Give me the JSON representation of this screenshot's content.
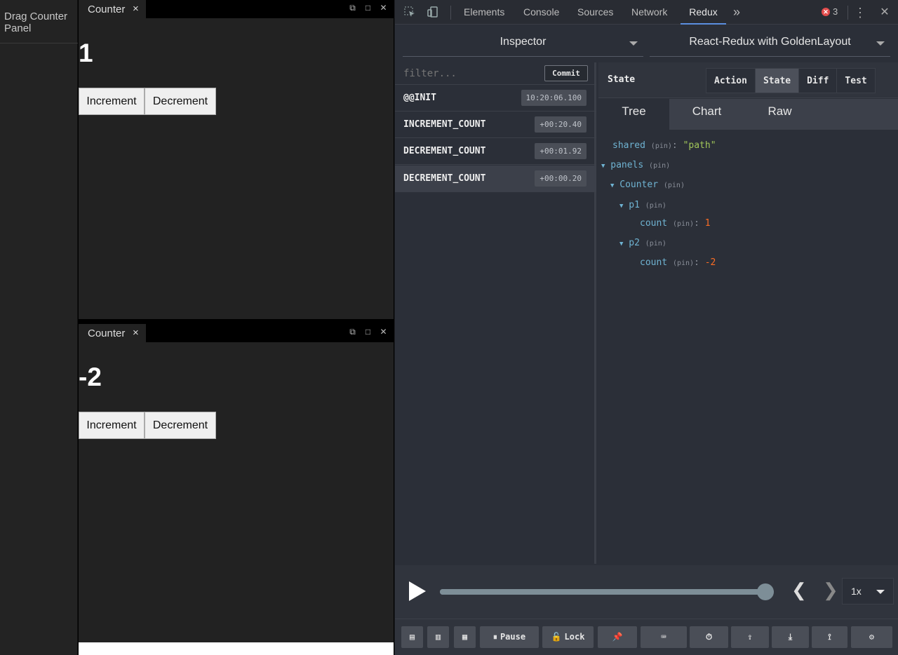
{
  "app": {
    "sidebar_item": "Drag Counter Panel",
    "panels": [
      {
        "tab": "Counter",
        "close": "×",
        "count": "1",
        "increment": "Increment",
        "decrement": "Decrement"
      },
      {
        "tab": "Counter",
        "close": "×",
        "count": "-2",
        "increment": "Increment",
        "decrement": "Decrement"
      }
    ],
    "window_controls": [
      "popout-icon",
      "maximize-icon",
      "close-icon"
    ]
  },
  "devtools": {
    "tabs": [
      "Elements",
      "Console",
      "Sources",
      "Network",
      "Redux"
    ],
    "active_tab": "Redux",
    "more": "»",
    "error_count": "3",
    "close": "✕",
    "menu": "⋮",
    "inspector_select": "Inspector",
    "instance_select": "React-Redux with GoldenLayout",
    "filter_placeholder": "filter...",
    "commit": "Commit",
    "actions": [
      {
        "name": "@@INIT",
        "time": "10:20:06.100",
        "selected": false
      },
      {
        "name": "INCREMENT_COUNT",
        "time": "+00:20.40",
        "selected": false
      },
      {
        "name": "DECREMENT_COUNT",
        "time": "+00:01.92",
        "selected": false
      },
      {
        "name": "DECREMENT_COUNT",
        "time": "+00:00.20",
        "selected": true
      }
    ],
    "right_title": "State",
    "segments": [
      "Action",
      "State",
      "Diff",
      "Test"
    ],
    "active_segment": "State",
    "view_tabs": [
      "Tree",
      "Chart",
      "Raw"
    ],
    "active_view": "Tree",
    "tree": {
      "pin": "(pin)",
      "shared_key": "shared",
      "shared_val": "\"path\"",
      "panels_key": "panels",
      "counter_key": "Counter",
      "p1_key": "p1",
      "p2_key": "p2",
      "count_key": "count",
      "p1_count": "1",
      "p2_count": "-2"
    },
    "slider": {
      "position_fraction": 1.0,
      "speed": "1x"
    },
    "bottom": {
      "pause": "Pause",
      "lock": "Lock",
      "icons": [
        "layout-left-icon",
        "layout-right-icon",
        "layout-bottom-icon",
        "pin-icon",
        "keyboard-icon",
        "timer-off-icon",
        "upload-icon",
        "download-icon",
        "remote-icon",
        "settings-icon"
      ]
    }
  }
}
